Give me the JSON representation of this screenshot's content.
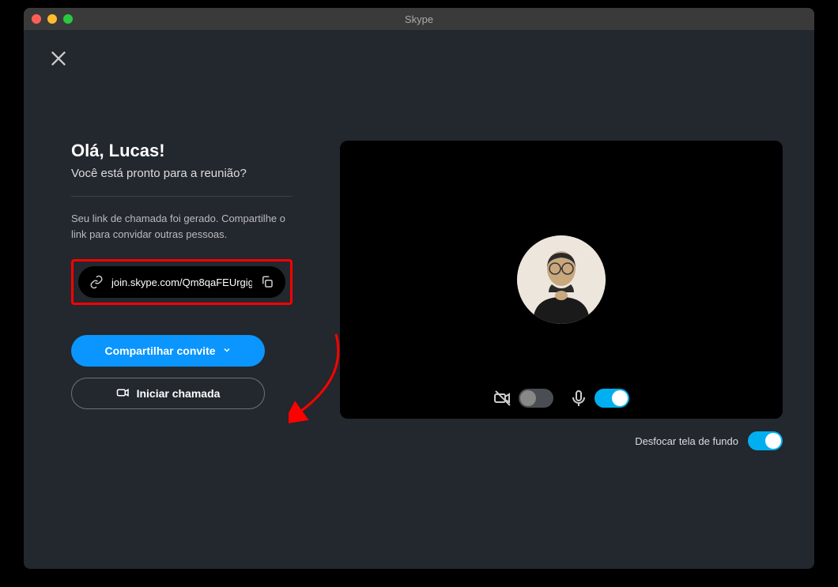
{
  "window": {
    "title": "Skype"
  },
  "left": {
    "greeting": "Olá, Lucas!",
    "subgreeting": "Você está pronto para a reunião?",
    "instruction": "Seu link de chamada foi gerado. Compartilhe o link para convidar outras pessoas.",
    "link_url": "join.skype.com/Qm8qaFEUrgig",
    "share_label": "Compartilhar convite",
    "start_label": "Iniciar chamada"
  },
  "controls": {
    "camera_on": false,
    "mic_on": true,
    "blur_label": "Desfocar tela de fundo",
    "blur_on": true
  },
  "colors": {
    "accent": "#0a95ff",
    "toggle_on": "#00aff0",
    "annotation": "#ff0000"
  }
}
